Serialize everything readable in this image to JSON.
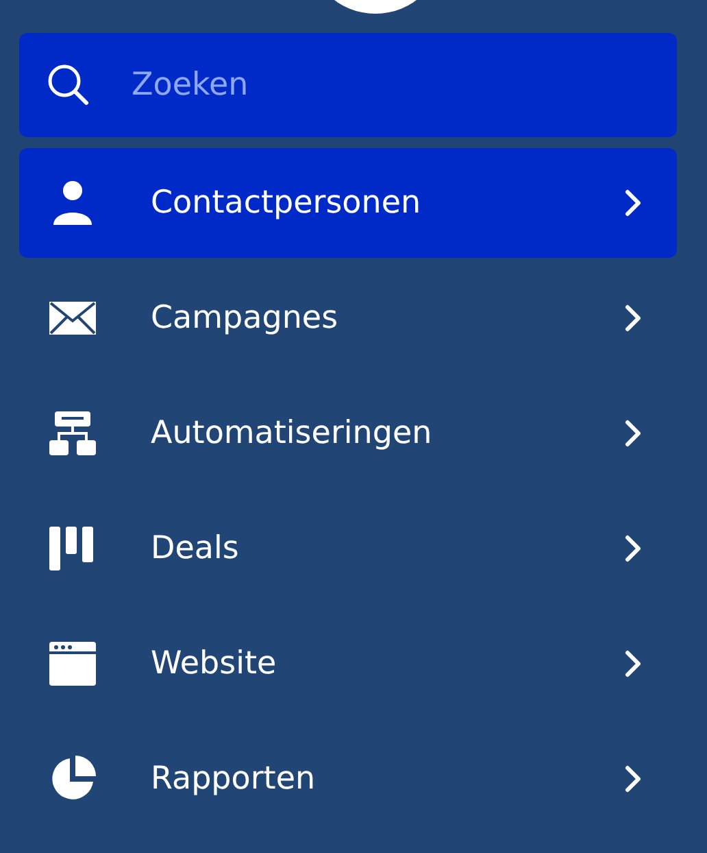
{
  "search": {
    "placeholder": "Zoeken"
  },
  "nav_items": [
    {
      "label": "Contactpersonen",
      "selected": true
    },
    {
      "label": "Campagnes",
      "selected": false
    },
    {
      "label": "Automatiseringen",
      "selected": false
    },
    {
      "label": "Deals",
      "selected": false
    },
    {
      "label": "Website",
      "selected": false
    },
    {
      "label": "Rapporten",
      "selected": false
    }
  ]
}
